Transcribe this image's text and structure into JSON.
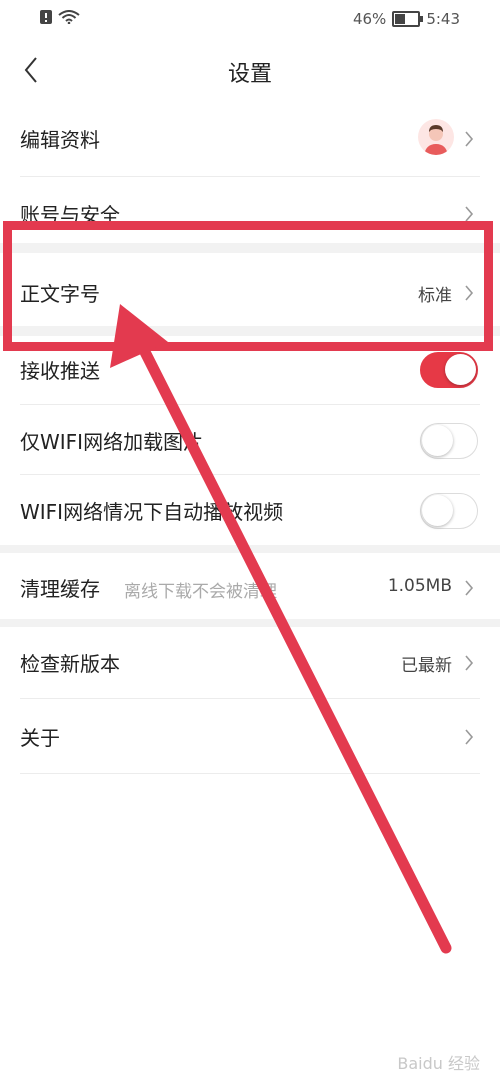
{
  "status_bar": {
    "battery": "46%",
    "time": "5:43",
    "battery_level": 0.46
  },
  "nav": {
    "title": "设置"
  },
  "rows": {
    "edit_profile": {
      "label": "编辑资料"
    },
    "account_security": {
      "label": "账号与安全"
    },
    "font_size": {
      "label": "正文字号",
      "value": "标准"
    },
    "push": {
      "label": "接收推送",
      "on": true
    },
    "wifi_images": {
      "label": "仅WIFI网络加载图片",
      "on": false
    },
    "wifi_autoplay": {
      "label": "WIFI网络情况下自动播放视频",
      "on": false
    },
    "clear_cache": {
      "label": "清理缓存",
      "sub": "离线下载不会被清理",
      "value": "1.05MB"
    },
    "check_update": {
      "label": "检查新版本",
      "value": "已最新"
    },
    "about": {
      "label": "关于"
    }
  },
  "colors": {
    "accent": "#e63946",
    "annotation": "#e33a4f"
  },
  "watermark": "Baidu 经验"
}
